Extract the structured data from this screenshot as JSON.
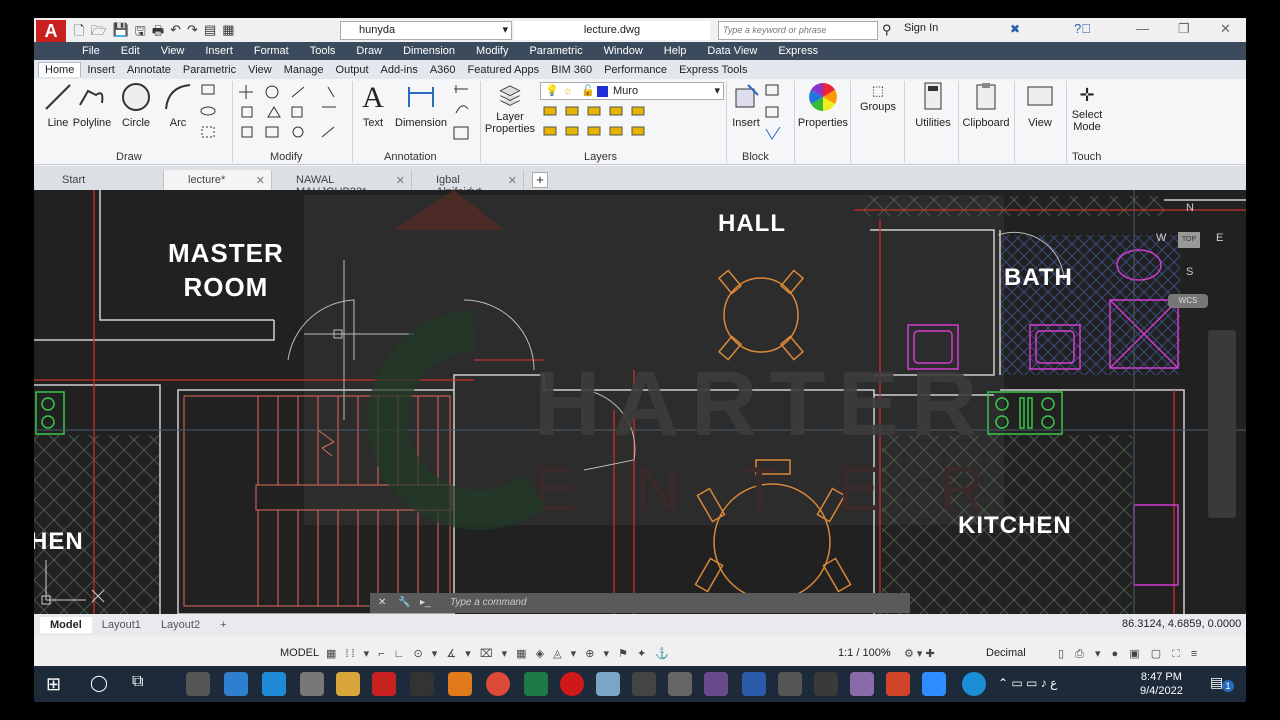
{
  "titlebar": {
    "workspace": "hunyda",
    "document_title": "lecture.dwg",
    "search_placeholder": "Type a keyword or phrase",
    "sign_in": "Sign In",
    "minimize": "—",
    "restore": "❐",
    "close": "✕"
  },
  "menu": [
    "File",
    "Edit",
    "View",
    "Insert",
    "Format",
    "Tools",
    "Draw",
    "Dimension",
    "Modify",
    "Parametric",
    "Window",
    "Help",
    "Data View",
    "Express"
  ],
  "ribbon_tabs": [
    "Home",
    "Insert",
    "Annotate",
    "Parametric",
    "View",
    "Manage",
    "Output",
    "Add-ins",
    "A360",
    "Featured Apps",
    "BIM 360",
    "Performance",
    "Express Tools"
  ],
  "ribbon": {
    "draw_tools": [
      "Line",
      "Polyline",
      "Circle",
      "Arc"
    ],
    "draw_panel": "Draw",
    "modify_panel": "Modify",
    "text_tool": "Text",
    "dimension_tool": "Dimension",
    "annotation_panel": "Annotation",
    "layer_properties_l1": "Layer",
    "layer_properties_l2": "Properties",
    "current_layer": "Muro",
    "layers_panel": "Layers",
    "insert_tool": "Insert",
    "block_panel": "Block",
    "properties": "Properties",
    "groups": "Groups",
    "utilities": "Utilities",
    "clipboard": "Clipboard",
    "view": "View",
    "select_mode_l1": "Select",
    "select_mode_l2": "Mode",
    "touch_panel": "Touch"
  },
  "doc_tabs": [
    "Start",
    "lecture*",
    "NAWAL MAHJOUB22*",
    "Igbal Alnifeidy*"
  ],
  "drawing": {
    "rooms": [
      "MASTER",
      "ROOM",
      "HALL",
      "BATH",
      "KITCHEN",
      "HEN"
    ],
    "watermark": [
      "HARTER",
      "ENTER"
    ],
    "viewcube": {
      "n": "N",
      "w": "W",
      "e": "E",
      "s": "S",
      "top": "TOP",
      "wcs": "WCS"
    },
    "command_placeholder": "Type a command"
  },
  "layout_tabs": [
    "Model",
    "Layout1",
    "Layout2"
  ],
  "coordinates": "86.3124, 4.6859, 0.0000",
  "statusbar": {
    "model": "MODEL",
    "scale": "1:1 / 100%",
    "units": "Decimal"
  },
  "taskbar": {
    "time": "8:47 PM",
    "date": "9/4/2022",
    "notifications": "1"
  },
  "colors": {
    "menubar": "#3c4a5e",
    "drawing_bg": "#212121",
    "wall_red": "#c8302a",
    "furniture_orange": "#d9883a",
    "fixture_magenta": "#d23cd2",
    "appliance_green": "#39c84a"
  }
}
